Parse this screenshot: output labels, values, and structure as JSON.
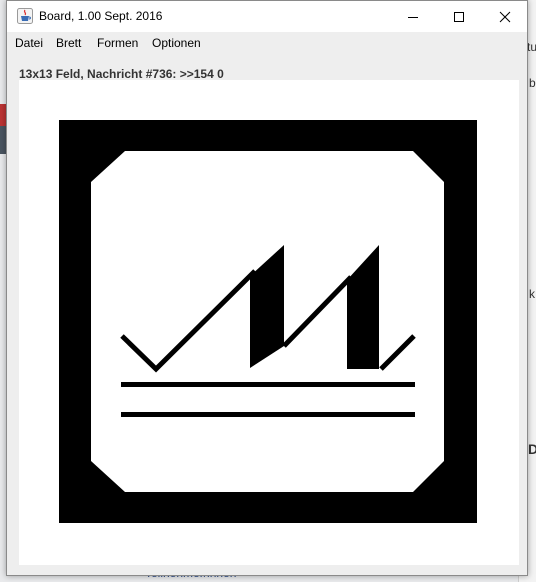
{
  "window": {
    "title": "Board, 1.00 Sept. 2016"
  },
  "menu": {
    "items": [
      "Datei",
      "Brett",
      "Formen",
      "Optionen"
    ]
  },
  "status": {
    "text": "13x13 Feld, Nachricht #736: >>154 0"
  },
  "background": {
    "bottom_text": "Teilnehmer/innen",
    "right_chars": [
      "tu",
      "b",
      "k",
      "D"
    ]
  },
  "colors": {
    "board_fill": "#000000",
    "board_background": "#ffffff",
    "window_background": "#eeeeee"
  },
  "icons": {
    "app": "java-cup-icon",
    "minimize": "minimize-icon",
    "maximize": "maximize-icon",
    "close": "close-icon"
  }
}
